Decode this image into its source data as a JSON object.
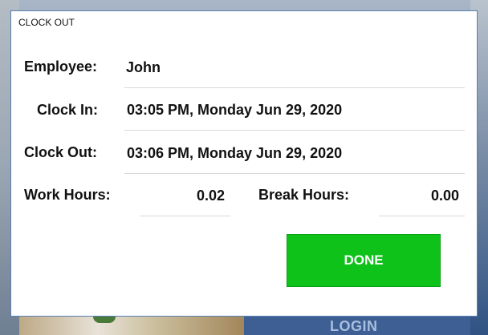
{
  "background": {
    "login_label": "LOGIN"
  },
  "dialog": {
    "title": "CLOCK OUT",
    "fields": {
      "employee": {
        "label": "Employee:",
        "value": "John"
      },
      "clock_in": {
        "label": "Clock In:",
        "value": "03:05 PM, Monday Jun 29, 2020"
      },
      "clock_out": {
        "label": "Clock Out:",
        "value": "03:06 PM, Monday Jun 29, 2020"
      },
      "work_hours": {
        "label": "Work Hours:",
        "value": "0.02"
      },
      "break_hours": {
        "label": "Break Hours:",
        "value": "0.00"
      }
    },
    "done_label": "DONE"
  },
  "colors": {
    "done_button": "#0ec21a",
    "dialog_border": "#5b7fb0",
    "separator": "#d9d9d9"
  }
}
